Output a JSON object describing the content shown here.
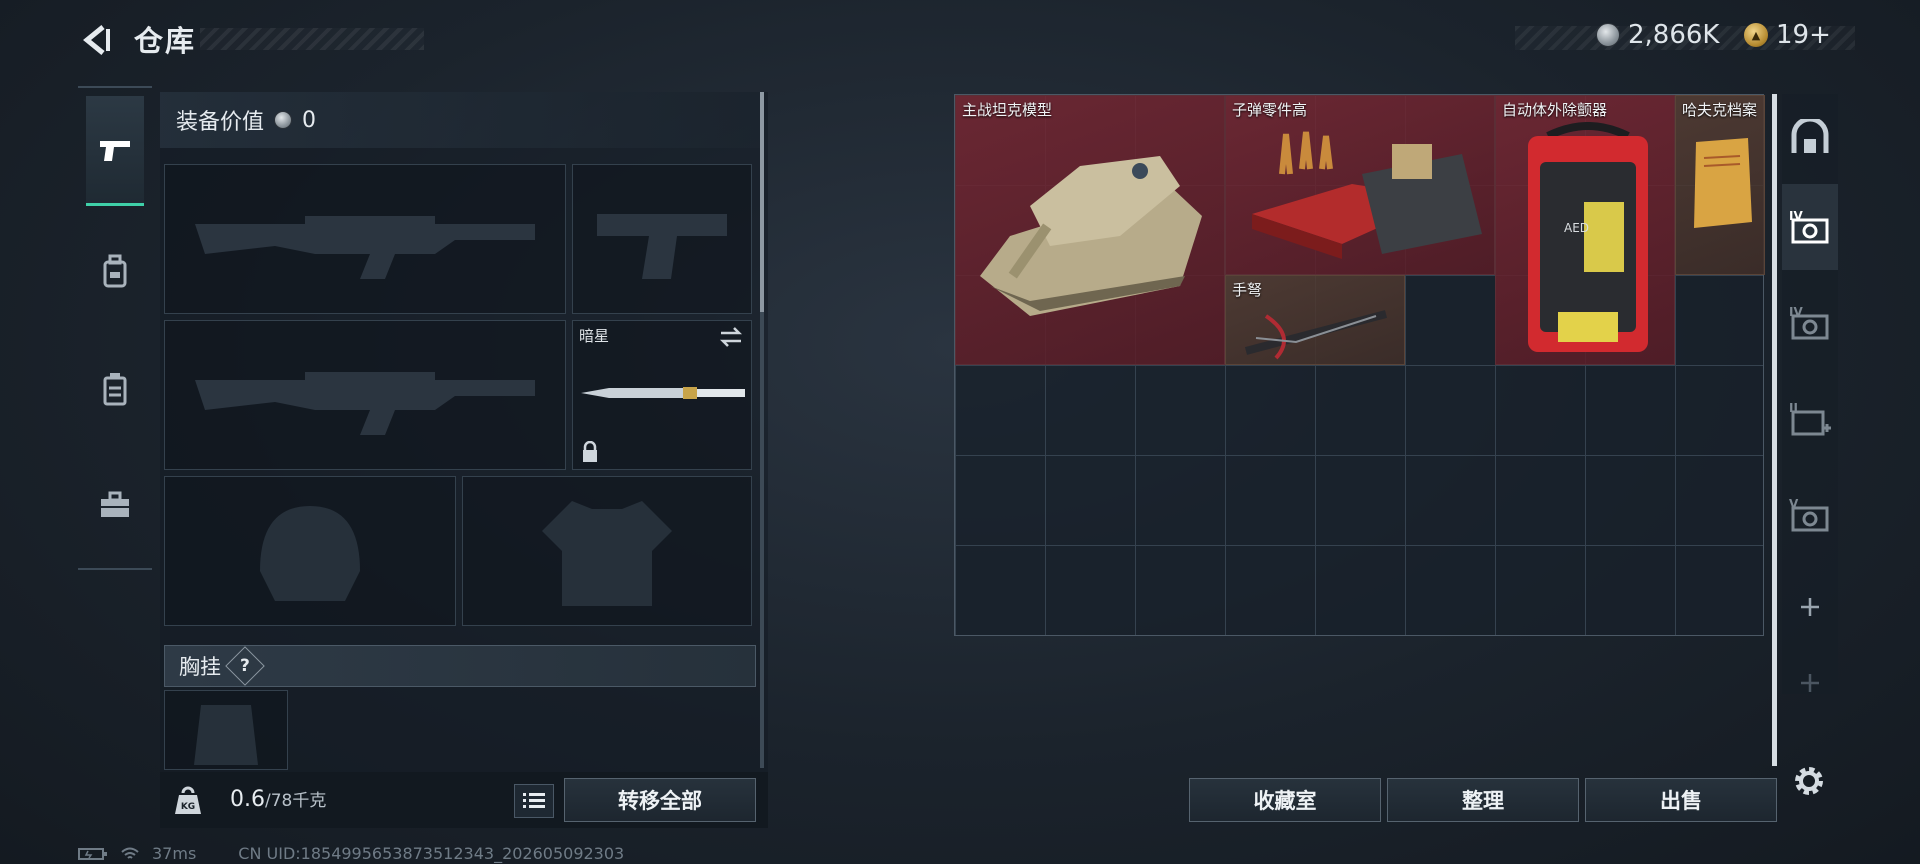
{
  "header": {
    "title": "仓库",
    "currency_silver": "2,866K",
    "currency_gold": "19+"
  },
  "loadout": {
    "value_label": "装备价值",
    "value_amount": "0",
    "melee_slot_label": "暗星",
    "chest_rig_label": "胸挂",
    "chest_rig_help": "?"
  },
  "weight": {
    "current": "0.6",
    "capacity": "/78千克"
  },
  "buttons": {
    "transfer_all": "转移全部",
    "collection": "收藏室",
    "organize": "整理",
    "sell": "出售"
  },
  "stash_items": [
    {
      "name": "主战坦克模型",
      "rarity": "red"
    },
    {
      "name": "子弹零件高",
      "rarity": "red"
    },
    {
      "name": "自动体外除颤器",
      "rarity": "red"
    },
    {
      "name": "哈夫克档案",
      "rarity": "brown"
    },
    {
      "name": "手弩",
      "rarity": "red"
    }
  ],
  "status_bar": {
    "ping": "37ms",
    "uid": "CN UID:1854995653873512343_202605092303"
  },
  "colors": {
    "accent": "#3fd0a8",
    "red_rarity": "#782834",
    "panel_border": "#34414d"
  }
}
